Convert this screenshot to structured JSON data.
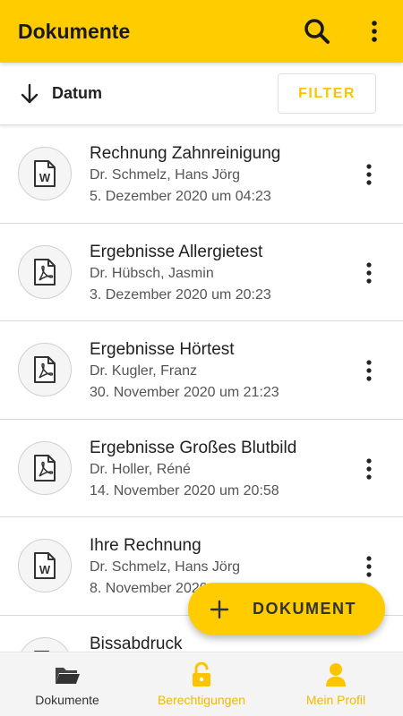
{
  "appbar": {
    "title": "Dokumente",
    "search_icon": "search-icon",
    "more_icon": "more-vert-icon"
  },
  "sortbar": {
    "sort_label": "Datum",
    "sort_icon": "arrow-down-icon",
    "filter_label": "FILTER"
  },
  "documents": [
    {
      "title": "Rechnung Zahnreinigung",
      "author": "Dr. Schmelz, Hans Jörg",
      "date": "5. Dezember 2020 um 04:23",
      "type": "word-doc-icon"
    },
    {
      "title": "Ergebnisse Allergietest",
      "author": "Dr. Hübsch, Jasmin",
      "date": "3. Dezember 2020 um 20:23",
      "type": "pdf-doc-icon"
    },
    {
      "title": "Ergebnisse Hörtest",
      "author": "Dr. Kugler, Franz",
      "date": "30. November 2020 um 21:23",
      "type": "pdf-doc-icon"
    },
    {
      "title": "Ergebnisse Großes Blutbild",
      "author": "Dr. Holler, Réné",
      "date": "14. November 2020 um 20:58",
      "type": "pdf-doc-icon"
    },
    {
      "title": "Ihre Rechnung",
      "author": "Dr. Schmelz, Hans Jörg",
      "date": "8. November 2020 um 10:15",
      "type": "word-doc-icon"
    },
    {
      "title": "Bissabdruck",
      "author": "",
      "date": "",
      "type": "word-doc-icon"
    }
  ],
  "fab": {
    "label": "DOKUMENT",
    "icon": "plus-icon"
  },
  "bottom_nav": [
    {
      "label": "Dokumente",
      "icon": "folder-icon"
    },
    {
      "label": "Berechtigungen",
      "icon": "unlock-icon"
    },
    {
      "label": "Mein Profil",
      "icon": "person-icon"
    }
  ],
  "colors": {
    "primary": "#FFCC00",
    "accent_text": "#F5B800"
  }
}
